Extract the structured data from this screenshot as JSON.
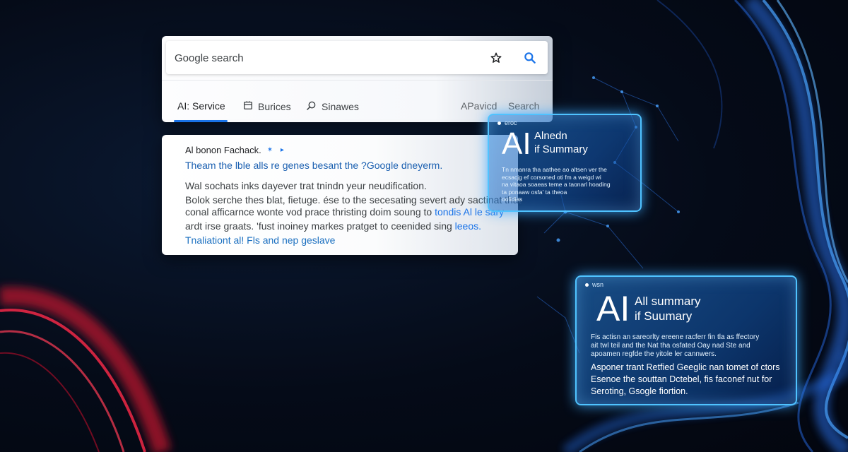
{
  "colors": {
    "accent": "#1a73e8",
    "glow": "#4fc3ff",
    "background": "#050b18"
  },
  "search": {
    "placeholder": "Google search",
    "star_icon": "star-icon",
    "search_icon": "search-icon",
    "tabs": [
      {
        "label": "AI: Service",
        "icon": ""
      },
      {
        "label": "Burices",
        "icon": "document-icon"
      },
      {
        "label": "Sinawes",
        "icon": "search-icon"
      }
    ],
    "right_links": [
      "APavicd",
      "Search"
    ]
  },
  "result": {
    "title": "Al bonon Fachack.",
    "line1": "Theam the lble alls re genes besant the ?Google dneyerm.",
    "line2": "Wal sochats inks dayever trat tnindn yeur neudification.",
    "line3": "Bolok serche thes blat, fietuge. ése to the secesating severt ady sactinat that",
    "line4_a": "conal afficarnce wonte vod prace thristing doim soung to",
    "line4_b": "tondis Al le sary",
    "line5_a": "ardt irse graats. 'fust inoiney markes pratget to ceenided sing",
    "line5_b": "leeos.",
    "link": "Tnaliationt al! Fls and nep geslave"
  },
  "ai_card_1": {
    "tag": "eroc",
    "big": "AI",
    "heading_1": "Alnedn",
    "heading_2": "if Summary",
    "body": [
      "Tn nmanra tha aathee ao altsen ver the",
      "ecsacjg ef corsoned oti fm a weigd wi",
      "na vitaoa soaeas teme a taonarl hoading",
      "ta ponaaw osfa' ta theoa",
      "oofidias"
    ]
  },
  "ai_card_2": {
    "tag": "wsn",
    "big": "AI",
    "heading_1": "All summary",
    "heading_2": "if Suumary",
    "body_small": [
      "Fis actisn an sareorlty ereene racferr fin tla as ffectory",
      "ait twl teil and the Nat tha osfated Oay nad Ste and",
      "apoamen regfde the yitole ler cannwers."
    ],
    "body_large": [
      "Asponer trant Retfied Geeglic nan tomet of ctors",
      "Esenoe the souttan Dctebel, fis faconef nut for",
      "Seroting, Gsogle fiortion."
    ]
  }
}
